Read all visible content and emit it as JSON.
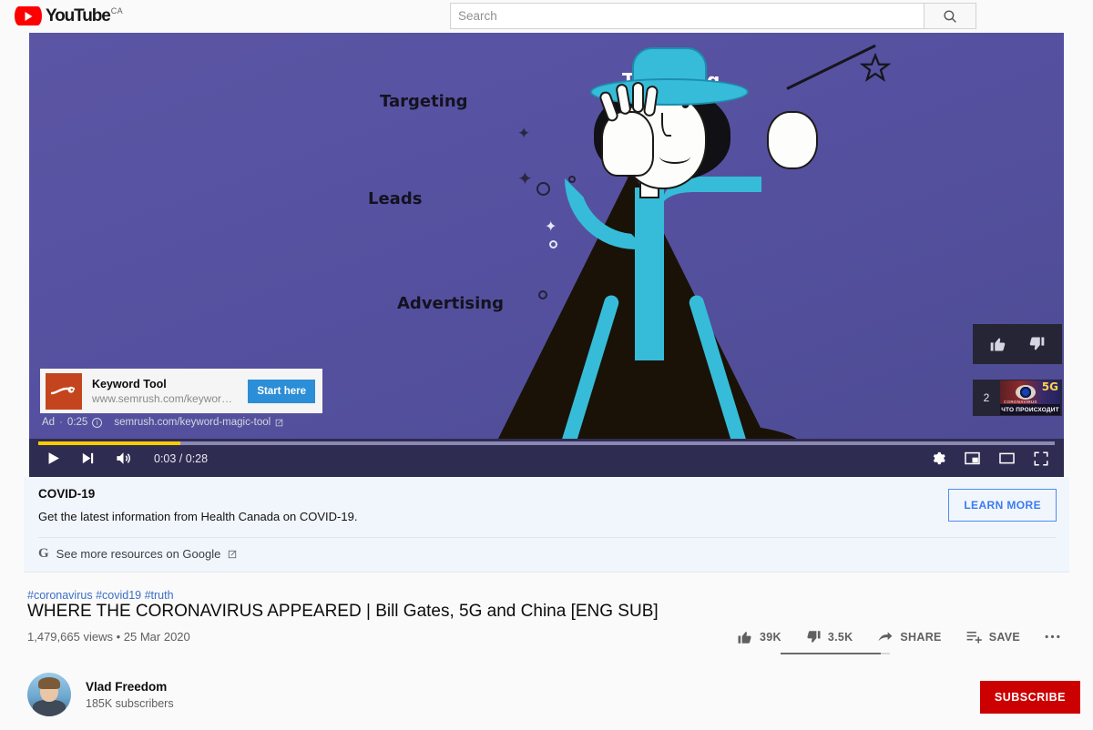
{
  "masthead": {
    "logo_text": "YouTube",
    "logo_country": "CA",
    "logo_icon": "youtube-play-icon",
    "search_placeholder": "Search",
    "search_value": "",
    "search_icon": "search-icon"
  },
  "player": {
    "scene_labels": {
      "targeting_top": "Targeting",
      "targeting": "Targeting",
      "leads": "Leads",
      "advertising": "Advertising"
    },
    "ad": {
      "title": "Keyword Tool",
      "display_url": "www.semrush.com/keywor…",
      "cta_label": "Start here",
      "badge": "Ad",
      "separator": "·",
      "duration": "0:25",
      "info_icon": "info-icon",
      "visit_url": "semrush.com/keyword-magic-tool",
      "external_icon": "external-link-icon"
    },
    "overlay": {
      "like_icon": "thumbs-up-icon",
      "dislike_icon": "thumbs-down-icon",
      "next_count": "2",
      "thumb_5g": "5G",
      "thumb_coronavirus": "CORONAVIRUS",
      "thumb_caption": "ЧТО ПРОИСХОДИТ"
    },
    "controls": {
      "play_icon": "play-icon",
      "next_icon": "next-video-icon",
      "volume_icon": "volume-icon",
      "time": "0:03 / 0:28",
      "current_time": "0:03",
      "duration": "0:28",
      "progress_percent": 14,
      "buffer_percent": 100,
      "settings_icon": "gear-icon",
      "miniplayer_icon": "miniplayer-icon",
      "theater_icon": "theater-mode-icon",
      "fullscreen_icon": "fullscreen-icon",
      "progress_color": "#ffcc00"
    }
  },
  "covid_panel": {
    "title": "COVID-19",
    "description": "Get the latest information from Health Canada on COVID-19.",
    "link_text": "See more resources on Google",
    "link_icon": "google-g-icon",
    "external_icon": "external-link-icon",
    "learn_more_label": "LEARN MORE",
    "accent_color": "#3a7bf0"
  },
  "video_info": {
    "hashtags": [
      "#coronavirus",
      "#covid19",
      "#truth"
    ],
    "title": "WHERE THE CORONAVIRUS APPEARED | Bill Gates, 5G and China [ENG SUB]",
    "views": "1,479,665 views",
    "separator": "•",
    "date": "25 Mar 2020",
    "actions": [
      {
        "label": "39K",
        "icon": "thumbs-up-icon",
        "name": "like"
      },
      {
        "label": "3.5K",
        "icon": "thumbs-down-icon",
        "name": "dislike"
      },
      {
        "label": "SHARE",
        "icon": "share-icon",
        "name": "share"
      },
      {
        "label": "SAVE",
        "icon": "save-icon",
        "name": "save"
      },
      {
        "label": "",
        "icon": "more-icon",
        "name": "more"
      }
    ],
    "like_ratio_percent": 92
  },
  "channel": {
    "name": "Vlad Freedom",
    "subscribers": "185K subscribers",
    "avatar_icon": "channel-avatar",
    "subscribe_label": "SUBSCRIBE",
    "subscribe_color": "#cc0000"
  }
}
